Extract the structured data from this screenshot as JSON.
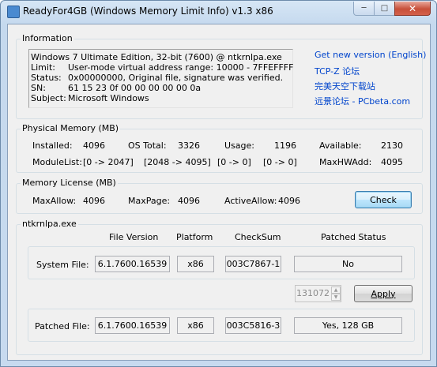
{
  "window": {
    "title": "ReadyFor4GB  (Windows Memory Limit Info) v1.3 x86",
    "minimize": "─",
    "maximize": "□",
    "close": "✕"
  },
  "information": {
    "label": "Information",
    "os_line": "Windows 7 Ultimate Edition, 32-bit (7600) @ ntkrnlpa.exe",
    "rows": [
      {
        "key": "Limit:",
        "value": "User-mode virtual address range: 10000 - 7FFEFFFF"
      },
      {
        "key": "Status:",
        "value": "0x00000000, Original file, signature was verified."
      },
      {
        "key": "SN:",
        "value": "61 15 23 0f 00 00 00 00 00 0a"
      },
      {
        "key": "Subject:",
        "value": "Microsoft Windows"
      }
    ],
    "links": [
      "Get new version (English)",
      "TCP-Z 论坛",
      "完美天空下载站",
      "远景论坛 - PCbeta.com"
    ]
  },
  "physical": {
    "label": "Physical Memory (MB)",
    "installed_label": "Installed:",
    "installed": "4096",
    "ostotal_label": "OS Total:",
    "ostotal": "3326",
    "usage_label": "Usage:",
    "usage": "1196",
    "available_label": "Available:",
    "available": "2130",
    "modulelist_label": "ModuleList:",
    "modulelist": [
      "[0 -> 2047]",
      "[2048 -> 4095]",
      "[0 -> 0]",
      "[0 -> 0]"
    ],
    "maxhwadd_label": "MaxHWAdd:",
    "maxhwadd": "4095"
  },
  "license": {
    "label": "Memory License (MB)",
    "maxallow_label": "MaxAllow:",
    "maxallow": "4096",
    "maxpage_label": "MaxPage:",
    "maxpage": "4096",
    "activeallow_label": "ActiveAllow:",
    "activeallow": "4096",
    "check_button": "Check"
  },
  "file": {
    "label": "ntkrnlpa.exe",
    "headers": [
      "File Version",
      "Platform",
      "CheckSum",
      "Patched Status"
    ],
    "system": {
      "label": "System File:",
      "version": "6.1.7600.16539",
      "platform": "x86",
      "checksum": "003C7867-1",
      "status": "No"
    },
    "spin_value": "131072",
    "apply_button": "Apply",
    "patched": {
      "label": "Patched File:",
      "version": "6.1.7600.16539",
      "platform": "x86",
      "checksum": "003C5816-3",
      "status": "Yes,  128 GB"
    }
  }
}
